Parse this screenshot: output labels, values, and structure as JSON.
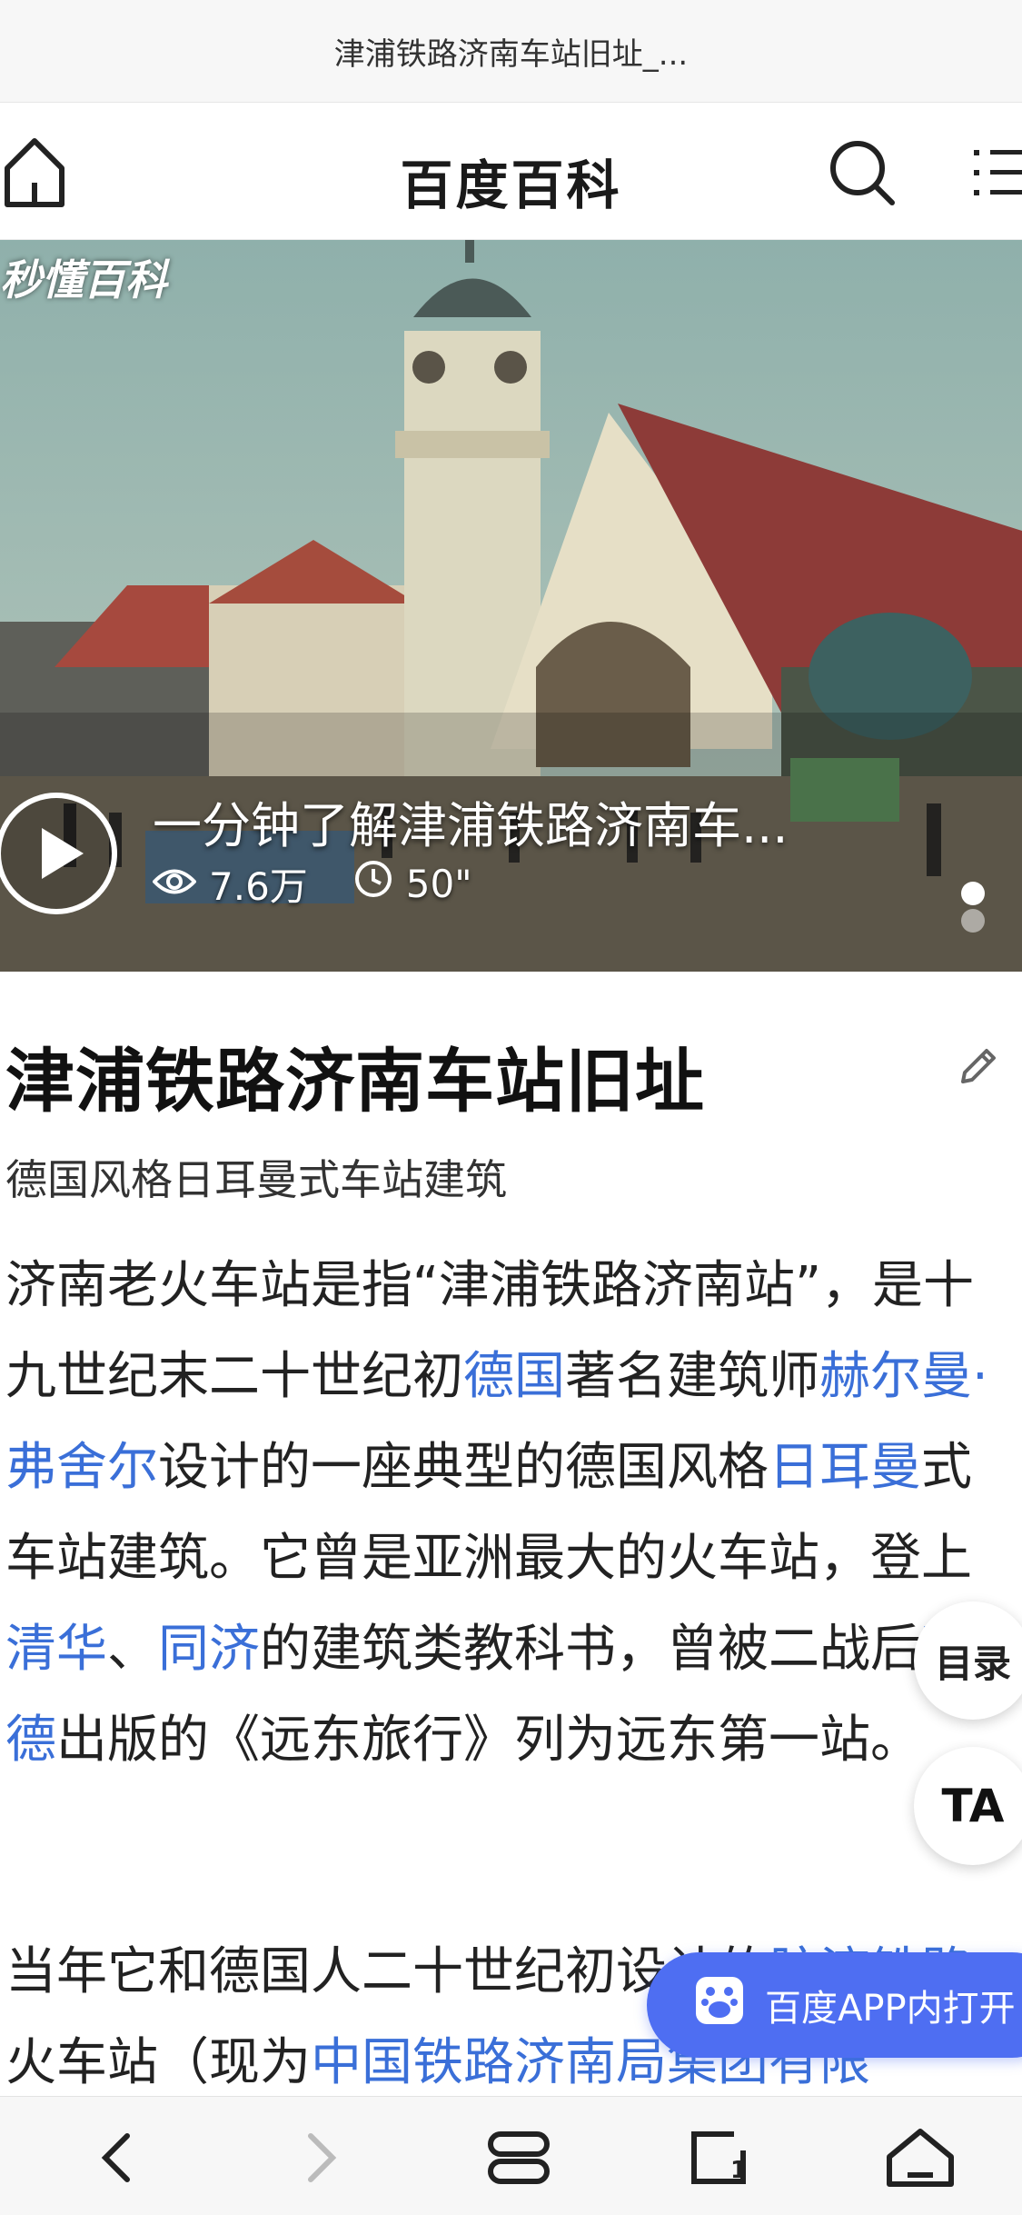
{
  "browser": {
    "url_title": "津浦铁路济南车站旧址_..."
  },
  "header": {
    "brand": "百度百科"
  },
  "hero": {
    "logo_text": "秒懂百科",
    "video_title": "一分钟了解津浦铁路济南车...",
    "views": "7.6万",
    "duration": "50\""
  },
  "article": {
    "title": "津浦铁路济南车站旧址",
    "subtitle": "德国风格日耳曼式车站建筑",
    "p1": {
      "t1": "济南老火车站是指“津浦铁路济南站”，是十九世纪末二十世纪初",
      "l1": "德国",
      "t2": "著名建筑师",
      "l2": "赫尔曼·弗舍尔",
      "t3": "设计的一座典型的德国风格",
      "l3": "日耳曼",
      "t4": "式车站建筑。它曾是亚洲最大的火车站，登上",
      "l4": "清华",
      "t5": "、",
      "l5": "同济",
      "t6": "的建筑类教科书，曾被二战后",
      "l6": "西德",
      "t7": "出版的《远东旅行》列为远东第一站。"
    },
    "p2": {
      "t1": "当年它和德国人二十世纪初设计的",
      "l1": "胶济铁路",
      "t2": "火车站（现为",
      "l2": "中国铁路济南局集团有限"
    }
  },
  "float": {
    "toc_label": "目录",
    "font_label": "TA"
  },
  "app_banner": {
    "label": "百度APP内打开"
  },
  "colors": {
    "link": "#3a6fd8",
    "banner": "#4e6ef2"
  }
}
